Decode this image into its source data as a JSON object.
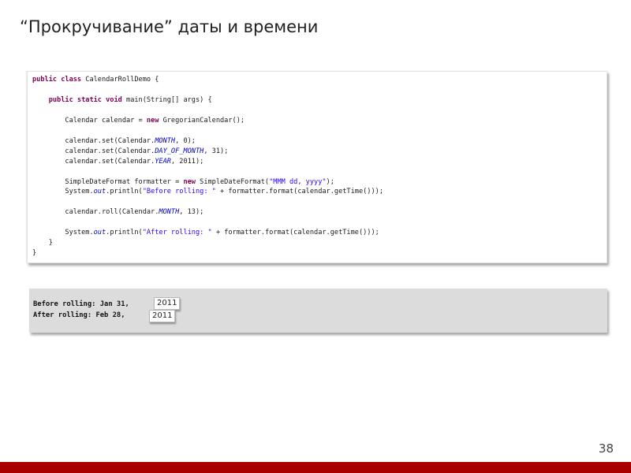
{
  "slide": {
    "title": "“Прокручивание” даты и времени",
    "page_number": "38"
  },
  "code_lines": [
    [
      {
        "t": "public class ",
        "c": "kw"
      },
      {
        "t": "CalendarRollDemo {"
      }
    ],
    [],
    [
      {
        "t": "    "
      },
      {
        "t": "public static void ",
        "c": "kw"
      },
      {
        "t": "main(String[] args) {"
      }
    ],
    [],
    [
      {
        "t": "        Calendar calendar = "
      },
      {
        "t": "new ",
        "c": "kw"
      },
      {
        "t": "GregorianCalendar();"
      }
    ],
    [],
    [
      {
        "t": "        calendar.set(Calendar."
      },
      {
        "t": "MONTH",
        "c": "fld"
      },
      {
        "t": ", 0);"
      }
    ],
    [
      {
        "t": "        calendar.set(Calendar."
      },
      {
        "t": "DAY_OF_MONTH",
        "c": "fld"
      },
      {
        "t": ", 31);"
      }
    ],
    [
      {
        "t": "        calendar.set(Calendar."
      },
      {
        "t": "YEAR",
        "c": "fld"
      },
      {
        "t": ", 2011);"
      }
    ],
    [],
    [
      {
        "t": "        SimpleDateFormat formatter = "
      },
      {
        "t": "new ",
        "c": "kw"
      },
      {
        "t": "SimpleDateFormat("
      },
      {
        "t": "\"MMM dd, yyyy\"",
        "c": "str"
      },
      {
        "t": ");"
      }
    ],
    [
      {
        "t": "        System."
      },
      {
        "t": "out",
        "c": "fld"
      },
      {
        "t": ".println("
      },
      {
        "t": "\"Before rolling: \"",
        "c": "str"
      },
      {
        "t": " + formatter.format(calendar.getTime()));"
      }
    ],
    [],
    [
      {
        "t": "        calendar.roll(Calendar."
      },
      {
        "t": "MONTH",
        "c": "fld"
      },
      {
        "t": ", 13);"
      }
    ],
    [],
    [
      {
        "t": "        System."
      },
      {
        "t": "out",
        "c": "fld"
      },
      {
        "t": ".println("
      },
      {
        "t": "\"After rolling: \"",
        "c": "str"
      },
      {
        "t": " + formatter.format(calendar.getTime()));"
      }
    ],
    [
      {
        "t": "    }"
      }
    ],
    [
      {
        "t": "}"
      }
    ]
  ],
  "output": {
    "line1": "Before rolling: Jan 31,",
    "line2": "After rolling: Feb 28,",
    "year_tag_1": "2011",
    "year_tag_2": "2011"
  },
  "colors": {
    "footer": "#a90000",
    "keyword": "#7f0055",
    "field": "#0000c0",
    "string": "#2a00ff",
    "output_bg": "#dcdcdc"
  }
}
